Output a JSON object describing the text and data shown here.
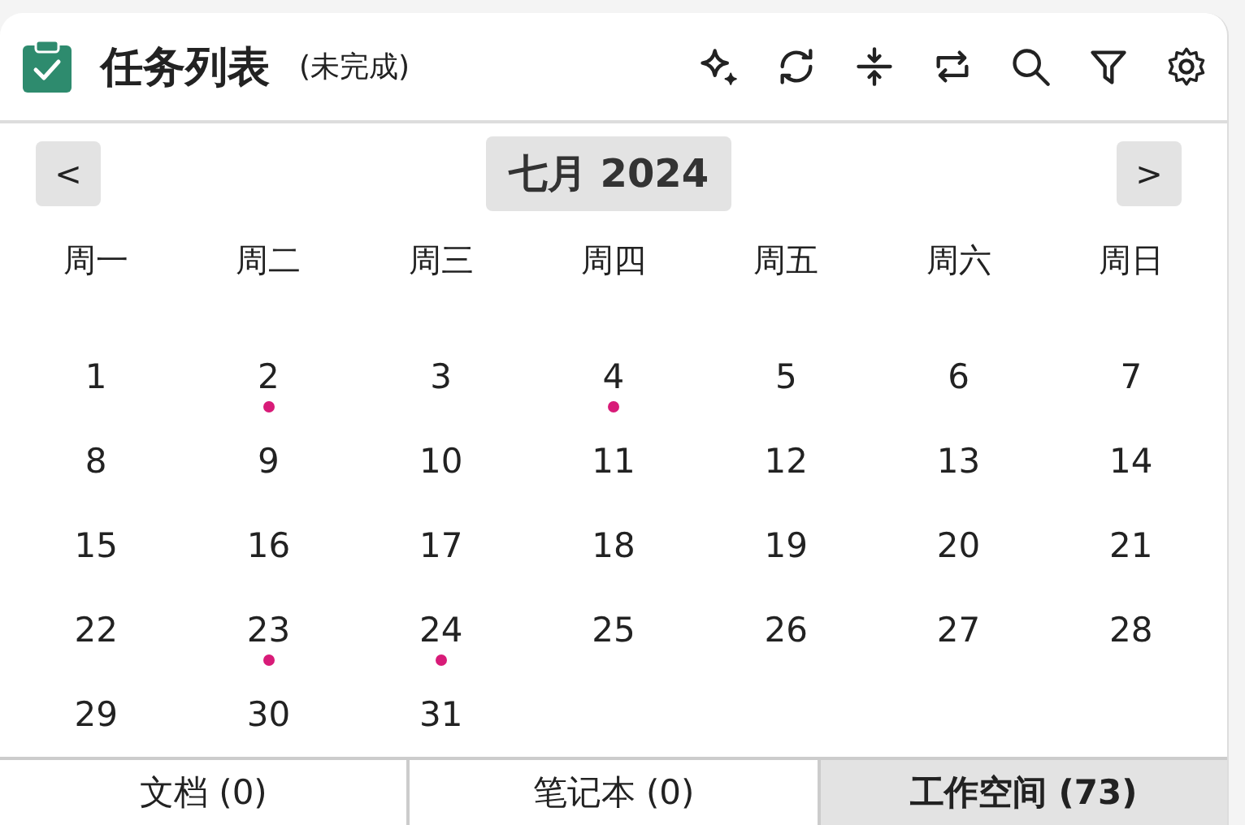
{
  "header": {
    "title": "任务列表",
    "subtitle": "(未完成)"
  },
  "calendar": {
    "month_label": "七月 2024",
    "prev": "<",
    "next": ">",
    "weekdays": [
      "周一",
      "周二",
      "周三",
      "周四",
      "周五",
      "周六",
      "周日"
    ],
    "weeks": [
      [
        {
          "day": "1",
          "has_task": false
        },
        {
          "day": "2",
          "has_task": true
        },
        {
          "day": "3",
          "has_task": false
        },
        {
          "day": "4",
          "has_task": true
        },
        {
          "day": "5",
          "has_task": false
        },
        {
          "day": "6",
          "has_task": false
        },
        {
          "day": "7",
          "has_task": false
        }
      ],
      [
        {
          "day": "8",
          "has_task": false
        },
        {
          "day": "9",
          "has_task": false
        },
        {
          "day": "10",
          "has_task": false
        },
        {
          "day": "11",
          "has_task": false
        },
        {
          "day": "12",
          "has_task": false
        },
        {
          "day": "13",
          "has_task": false
        },
        {
          "day": "14",
          "has_task": false
        }
      ],
      [
        {
          "day": "15",
          "has_task": false
        },
        {
          "day": "16",
          "has_task": false
        },
        {
          "day": "17",
          "has_task": false
        },
        {
          "day": "18",
          "has_task": false
        },
        {
          "day": "19",
          "has_task": false
        },
        {
          "day": "20",
          "has_task": false
        },
        {
          "day": "21",
          "has_task": false
        }
      ],
      [
        {
          "day": "22",
          "has_task": false
        },
        {
          "day": "23",
          "has_task": true
        },
        {
          "day": "24",
          "has_task": true
        },
        {
          "day": "25",
          "has_task": false
        },
        {
          "day": "26",
          "has_task": false
        },
        {
          "day": "27",
          "has_task": false
        },
        {
          "day": "28",
          "has_task": false
        }
      ],
      [
        {
          "day": "29",
          "has_task": false
        },
        {
          "day": "30",
          "has_task": false
        },
        {
          "day": "31",
          "has_task": false
        }
      ]
    ]
  },
  "tabs": [
    {
      "label": "文档 (0)",
      "selected": false
    },
    {
      "label": "笔记本 (0)",
      "selected": false
    },
    {
      "label": "工作空间 (73)",
      "selected": true
    }
  ]
}
